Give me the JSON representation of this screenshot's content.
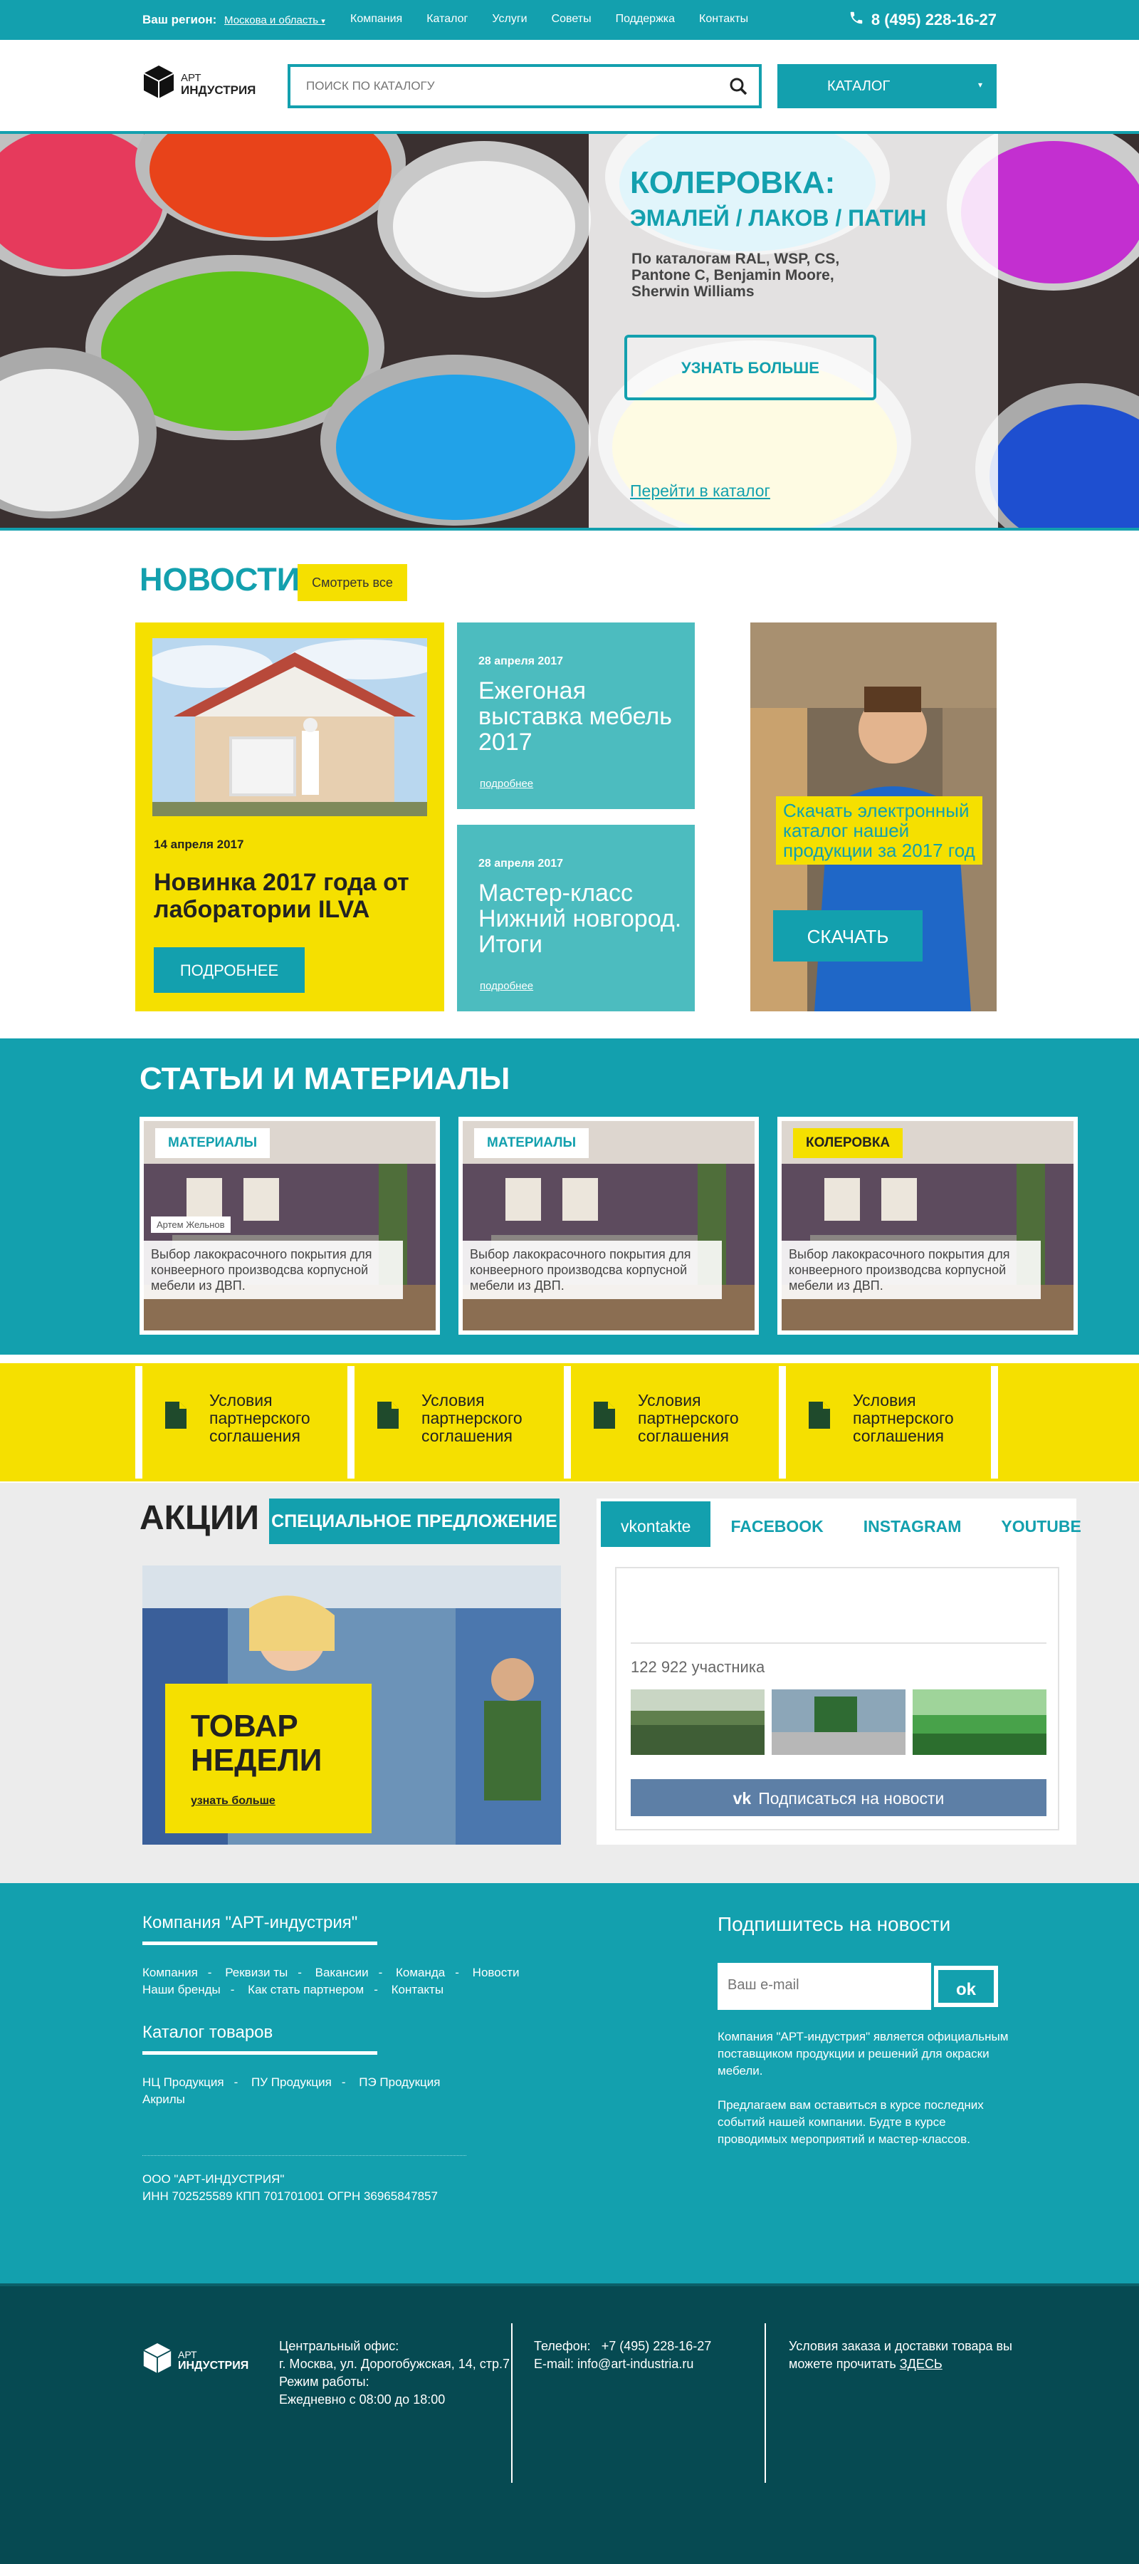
{
  "topbar": {
    "region_label": "Ваш регион:",
    "region_value": "Москова и область",
    "region_arrow": "▾",
    "nav": [
      "Компания",
      "Каталог",
      "Услуги",
      "Советы",
      "Поддержка",
      "Контакты"
    ],
    "phone": "8 (495) 228-16-27"
  },
  "header": {
    "logo_line1": "АРТ",
    "logo_line2": "ИНДУСТРИЯ",
    "search_placeholder": "ПОИСК ПО КАТАЛОГУ",
    "catalog_label": "КАТАЛОГ",
    "catalog_arrow": "▾"
  },
  "hero": {
    "title": "КОЛЕРОВКА:",
    "subtitle": "ЭМАЛЕЙ / ЛАКОВ / ПАТИН",
    "description": "По каталогам RAL, WSP, CS, Pantone C, Benjamin Moore, Sherwin Williams",
    "button": "УЗНАТЬ БОЛЬШЕ",
    "link": "Перейти в каталог"
  },
  "news": {
    "title": "НОВОСТИ",
    "see_all": "Смотреть все",
    "main": {
      "date": "14 апреля 2017",
      "headline": "Новинка 2017 года от лаборатории ILVA",
      "button": "ПОДРОБНЕЕ"
    },
    "cards": [
      {
        "date": "28 апреля 2017",
        "headline": "Ежегоная выставка мебель 2017",
        "more": "подробнее"
      },
      {
        "date": "28 апреля 2017",
        "headline": "Мастер-класс Нижний новгород. Итоги",
        "more": "подробнее"
      }
    ],
    "promo": {
      "text": "Скачать электронный каталог нашей продукции за 2017 год",
      "button": "СКАЧАТЬ"
    }
  },
  "articles": {
    "title": "СТАТЬИ И МАТЕРИАЛЫ",
    "items": [
      {
        "tag": "МАТЕРИАЛЫ",
        "author": "Артем Жельнов",
        "description": "Выбор лакокрасочного покрытия для конвеерного производсва корпусной мебели из ДВП."
      },
      {
        "tag": "МАТЕРИАЛЫ",
        "author": "",
        "description": "Выбор лакокрасочного покрытия для конвеерного производсва корпусной мебели из ДВП."
      },
      {
        "tag": "КОЛЕРОВКА",
        "author": "",
        "description": "Выбор лакокрасочного покрытия для конвеерного производсва корпусной мебели из ДВП."
      }
    ]
  },
  "partners": {
    "items": [
      "Условия партнерского соглашения",
      "Условия партнерского соглашения",
      "Условия партнерского соглашения",
      "Условия партнерского соглашения"
    ]
  },
  "actions": {
    "title": "АКЦИИ",
    "special": "СПЕЦИАЛЬНОЕ ПРЕДЛОЖЕНИЕ",
    "week_title_1": "ТОВАР",
    "week_title_2": "НЕДЕЛИ",
    "week_link": "узнать больше"
  },
  "social": {
    "tabs": [
      "vkontakte",
      "FACEBOOK",
      "INSTAGRAM",
      "YOUTUBE"
    ],
    "members": "122 922 участника",
    "subscribe": "Подписаться на новости"
  },
  "footer": {
    "company_head": "Компания \"АРТ-индустрия\"",
    "company_links_row1": [
      "Компания",
      "Реквизи ты",
      "Вакансии",
      "Команда",
      "Новости"
    ],
    "company_links_row2": [
      "Наши бренды",
      "Как стать партнером",
      "Контакты"
    ],
    "catalog_head": "Каталог товаров",
    "catalog_links_row1": [
      "НЦ Продукция",
      "ПУ Продукция",
      "ПЭ Продукция"
    ],
    "catalog_links_row2": [
      "Акрилы"
    ],
    "legal_1": "ООО \"АРТ-ИНДУСТРИЯ\"",
    "legal_2": "ИНН 702525589 КПП 701701001 ОГРН 36965847857",
    "subscribe_head": "Подпишитесь на новости",
    "email_placeholder": "Ваш e-mail",
    "ok": "ok",
    "about_1": "Компания \"АРТ-индустрия\" является официальным поставщиком продукции и решений для окраски мебели.",
    "about_2": "Предлагаем вам оставиться в курсе последних событий нашей компании. Будте в курсе проводимых мероприятий и мастер-классов."
  },
  "bottom": {
    "logo_line1": "АРТ",
    "logo_line2": "ИНДУСТРИЯ",
    "office_label": "Центральный офис:",
    "office_address": "г. Москва, ул. Дорогобужская, 14, стр.7",
    "hours_label": "Режим работы:",
    "hours_value": "Ежедневно с 08:00 до 18:00",
    "phone_label": "Телефон:",
    "phone_value": "+7 (495) 228-16-27",
    "email_label": "E-mail:",
    "email_value": "info@art-industria.ru",
    "delivery_text": "Условия заказа и доставки товара вы можете прочитать",
    "delivery_link": "ЗДЕСЬ"
  },
  "colors": {
    "teal": "#13a0ae",
    "yellow": "#f5e000",
    "dark_footer": "#064a52",
    "vk_blue": "#5d7fa6"
  },
  "icons": [
    "phone-icon",
    "logo-cube-icon",
    "search-icon",
    "document-icon",
    "vk-icon"
  ]
}
